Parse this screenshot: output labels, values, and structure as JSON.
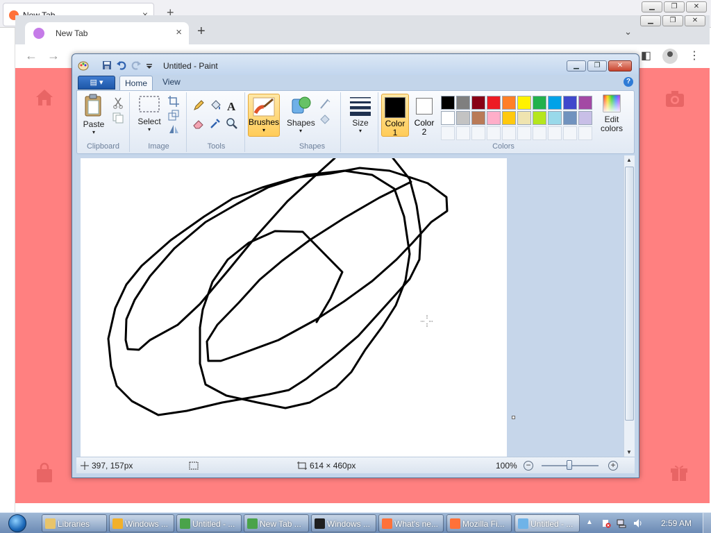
{
  "firefox": {
    "tab_title": "New Tab",
    "close_glyph": "×",
    "new_tab_glyph": "+"
  },
  "chrome": {
    "tab_title": "New Tab",
    "close_glyph": "×",
    "new_tab_glyph": "+",
    "back_glyph": "←",
    "forward_glyph": "→",
    "more_glyph": "⋮",
    "tab_list_glyph": "⌄",
    "background_color": "#ff8080"
  },
  "paint": {
    "title": "Untitled - Paint",
    "tabs": {
      "file": "▤ ▾",
      "home": "Home",
      "view": "View"
    },
    "ribbon": {
      "clipboard": {
        "paste": "Paste",
        "group": "Clipboard"
      },
      "image": {
        "select": "Select",
        "group": "Image"
      },
      "tools": {
        "group": "Tools"
      },
      "brushes": {
        "label": "Brushes"
      },
      "shapes": {
        "label": "Shapes",
        "group": "Shapes"
      },
      "size": {
        "label": "Size"
      },
      "colors": {
        "color1": "Color",
        "color1_num": "1",
        "color2": "Color",
        "color2_num": "2",
        "edit1": "Edit",
        "edit2": "colors",
        "group": "Colors",
        "color1_value": "#000000",
        "color2_value": "#ffffff",
        "palette": [
          "#000000",
          "#7f7f7f",
          "#880015",
          "#ed1c24",
          "#ff7f27",
          "#fff200",
          "#22b14c",
          "#00a2e8",
          "#3f48cc",
          "#a349a4",
          "#ffffff",
          "#c3c3c3",
          "#b97a57",
          "#ffaec9",
          "#ffc90e",
          "#efe4b0",
          "#b5e61d",
          "#99d9ea",
          "#7092be",
          "#c8bfe7"
        ]
      }
    },
    "status": {
      "cursor_pos": "397, 157px",
      "canvas_size": "614 × 460px",
      "zoom": "100%"
    }
  },
  "taskbar": {
    "items": [
      {
        "label": "Libraries",
        "icon_color": "#e8c46a"
      },
      {
        "label": "Windows ...",
        "icon_color": "#f2b02a"
      },
      {
        "label": "Untitled - ...",
        "icon_color": "#4aa34a"
      },
      {
        "label": "New Tab ...",
        "icon_color": "#4aa34a"
      },
      {
        "label": "Windows ...",
        "icon_color": "#1f1f1f"
      },
      {
        "label": "What's ne...",
        "icon_color": "#ff7139"
      },
      {
        "label": "Mozilla Fi...",
        "icon_color": "#ff7139"
      },
      {
        "label": "Untitled - ...",
        "icon_color": "#6fb3e8"
      }
    ],
    "clock": "2:59 AM",
    "tray_expand": "▲"
  }
}
